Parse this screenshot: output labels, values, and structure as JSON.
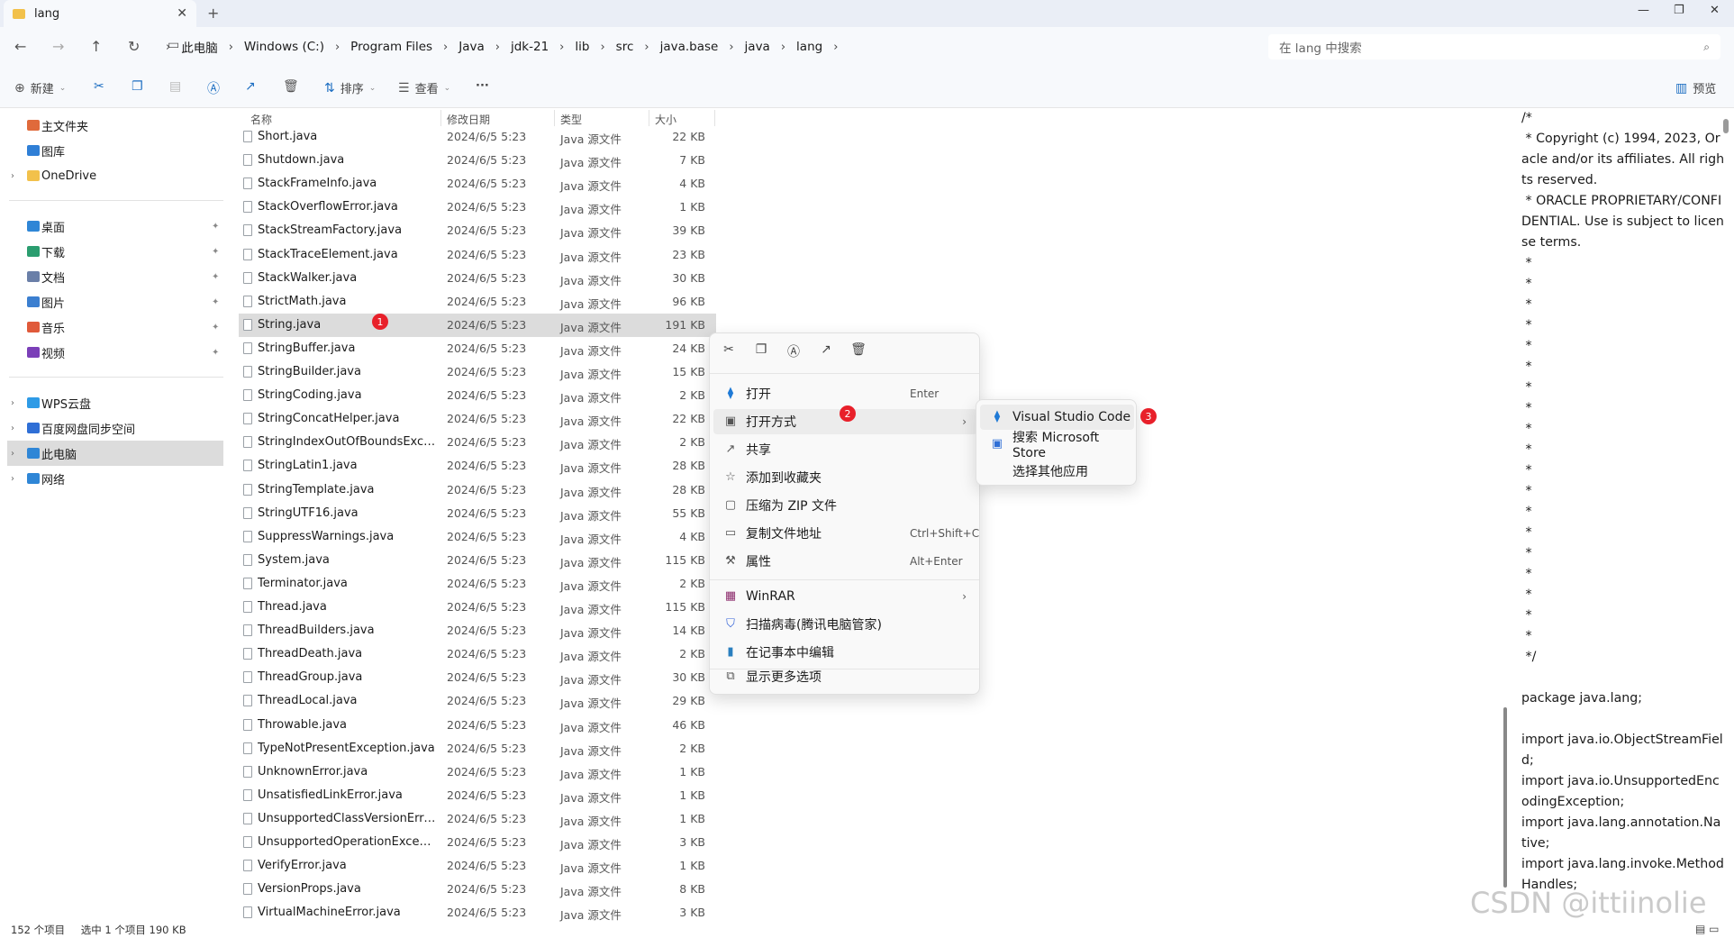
{
  "window": {
    "tab_title": "lang",
    "tab_close": "✕",
    "new_tab": "+",
    "minimize": "—",
    "restore": "❐",
    "close": "✕"
  },
  "address": {
    "crumbs": [
      "此电脑",
      "Windows (C:)",
      "Program Files",
      "Java",
      "jdk-21",
      "lib",
      "src",
      "java.base",
      "java",
      "lang"
    ],
    "search_placeholder": "在 lang 中搜索"
  },
  "toolbar": {
    "new_label": "新建",
    "sort_label": "排序",
    "view_label": "查看",
    "more_label": "···",
    "preview_label": "预览"
  },
  "sidebar": {
    "quick": [
      {
        "label": "主文件夹",
        "color": "#e06a3b"
      },
      {
        "label": "图库",
        "color": "#2f7fd6"
      },
      {
        "label": "OneDrive",
        "color": "#f2c14b"
      }
    ],
    "pinned": [
      {
        "label": "桌面",
        "color": "#2f86d6"
      },
      {
        "label": "下载",
        "color": "#2a9d6f"
      },
      {
        "label": "文档",
        "color": "#6a7fa8"
      },
      {
        "label": "图片",
        "color": "#3b7fd0"
      },
      {
        "label": "音乐",
        "color": "#e05a3a"
      },
      {
        "label": "视频",
        "color": "#7b3fb8"
      }
    ],
    "places": [
      {
        "label": "WPS云盘",
        "color": "#2e9be6"
      },
      {
        "label": "百度网盘同步空间",
        "color": "#2f6fd6"
      },
      {
        "label": "此电脑",
        "color": "#2f86d6"
      },
      {
        "label": "网络",
        "color": "#2f86d6"
      }
    ]
  },
  "list": {
    "headers": {
      "name": "名称",
      "date": "修改日期",
      "type": "类型",
      "size": "大小"
    },
    "rows": [
      {
        "name": "Short.java",
        "date": "2024/6/5 5:23",
        "type": "Java 源文件",
        "size": "22 KB"
      },
      {
        "name": "Shutdown.java",
        "date": "2024/6/5 5:23",
        "type": "Java 源文件",
        "size": "7 KB"
      },
      {
        "name": "StackFrameInfo.java",
        "date": "2024/6/5 5:23",
        "type": "Java 源文件",
        "size": "4 KB"
      },
      {
        "name": "StackOverflowError.java",
        "date": "2024/6/5 5:23",
        "type": "Java 源文件",
        "size": "1 KB"
      },
      {
        "name": "StackStreamFactory.java",
        "date": "2024/6/5 5:23",
        "type": "Java 源文件",
        "size": "39 KB"
      },
      {
        "name": "StackTraceElement.java",
        "date": "2024/6/5 5:23",
        "type": "Java 源文件",
        "size": "23 KB"
      },
      {
        "name": "StackWalker.java",
        "date": "2024/6/5 5:23",
        "type": "Java 源文件",
        "size": "30 KB"
      },
      {
        "name": "StrictMath.java",
        "date": "2024/6/5 5:23",
        "type": "Java 源文件",
        "size": "96 KB"
      },
      {
        "name": "String.java",
        "date": "2024/6/5 5:23",
        "type": "Java 源文件",
        "size": "191 KB"
      },
      {
        "name": "StringBuffer.java",
        "date": "2024/6/5 5:23",
        "type": "Java 源文件",
        "size": "24 KB"
      },
      {
        "name": "StringBuilder.java",
        "date": "2024/6/5 5:23",
        "type": "Java 源文件",
        "size": "15 KB"
      },
      {
        "name": "StringCoding.java",
        "date": "2024/6/5 5:23",
        "type": "Java 源文件",
        "size": "2 KB"
      },
      {
        "name": "StringConcatHelper.java",
        "date": "2024/6/5 5:23",
        "type": "Java 源文件",
        "size": "22 KB"
      },
      {
        "name": "StringIndexOutOfBoundsExcepti...",
        "date": "2024/6/5 5:23",
        "type": "Java 源文件",
        "size": "2 KB"
      },
      {
        "name": "StringLatin1.java",
        "date": "2024/6/5 5:23",
        "type": "Java 源文件",
        "size": "28 KB"
      },
      {
        "name": "StringTemplate.java",
        "date": "2024/6/5 5:23",
        "type": "Java 源文件",
        "size": "28 KB"
      },
      {
        "name": "StringUTF16.java",
        "date": "2024/6/5 5:23",
        "type": "Java 源文件",
        "size": "55 KB"
      },
      {
        "name": "SuppressWarnings.java",
        "date": "2024/6/5 5:23",
        "type": "Java 源文件",
        "size": "4 KB"
      },
      {
        "name": "System.java",
        "date": "2024/6/5 5:23",
        "type": "Java 源文件",
        "size": "115 KB"
      },
      {
        "name": "Terminator.java",
        "date": "2024/6/5 5:23",
        "type": "Java 源文件",
        "size": "2 KB"
      },
      {
        "name": "Thread.java",
        "date": "2024/6/5 5:23",
        "type": "Java 源文件",
        "size": "115 KB"
      },
      {
        "name": "ThreadBuilders.java",
        "date": "2024/6/5 5:23",
        "type": "Java 源文件",
        "size": "14 KB"
      },
      {
        "name": "ThreadDeath.java",
        "date": "2024/6/5 5:23",
        "type": "Java 源文件",
        "size": "2 KB"
      },
      {
        "name": "ThreadGroup.java",
        "date": "2024/6/5 5:23",
        "type": "Java 源文件",
        "size": "30 KB"
      },
      {
        "name": "ThreadLocal.java",
        "date": "2024/6/5 5:23",
        "type": "Java 源文件",
        "size": "29 KB"
      },
      {
        "name": "Throwable.java",
        "date": "2024/6/5 5:23",
        "type": "Java 源文件",
        "size": "46 KB"
      },
      {
        "name": "TypeNotPresentException.java",
        "date": "2024/6/5 5:23",
        "type": "Java 源文件",
        "size": "2 KB"
      },
      {
        "name": "UnknownError.java",
        "date": "2024/6/5 5:23",
        "type": "Java 源文件",
        "size": "1 KB"
      },
      {
        "name": "UnsatisfiedLinkError.java",
        "date": "2024/6/5 5:23",
        "type": "Java 源文件",
        "size": "1 KB"
      },
      {
        "name": "UnsupportedClassVersionError.ja...",
        "date": "2024/6/5 5:23",
        "type": "Java 源文件",
        "size": "1 KB"
      },
      {
        "name": "UnsupportedOperationExceptio...",
        "date": "2024/6/5 5:23",
        "type": "Java 源文件",
        "size": "3 KB"
      },
      {
        "name": "VerifyError.java",
        "date": "2024/6/5 5:23",
        "type": "Java 源文件",
        "size": "1 KB"
      },
      {
        "name": "VersionProps.java",
        "date": "2024/6/5 5:23",
        "type": "Java 源文件",
        "size": "8 KB"
      },
      {
        "name": "VirtualMachineError.java",
        "date": "2024/6/5 5:23",
        "type": "Java 源文件",
        "size": "3 KB"
      }
    ]
  },
  "badges": {
    "one": "1",
    "two": "2",
    "three": "3"
  },
  "context_menu": {
    "open": "打开",
    "open_shortcut": "Enter",
    "open_with": "打开方式",
    "share": "共享",
    "add_favorite": "添加到收藏夹",
    "zip": "压缩为 ZIP 文件",
    "copy_path": "复制文件地址",
    "copy_path_shortcut": "Ctrl+Shift+C",
    "properties": "属性",
    "properties_shortcut": "Alt+Enter",
    "winrar": "WinRAR",
    "scan": "扫描病毒(腾讯电脑管家)",
    "notepad": "在记事本中编辑",
    "more_options": "显示更多选项"
  },
  "submenu": {
    "vscode": "Visual Studio Code",
    "store": "搜索 Microsoft Store",
    "other": "选择其他应用"
  },
  "preview": {
    "code": "/*\n * Copyright (c) 1994, 2023, Oracle and/or its affiliates. All rights reserved.\n * ORACLE PROPRIETARY/CONFIDENTIAL. Use is subject to license terms.\n *\n *\n *\n *\n *\n *\n *\n *\n *\n *\n *\n *\n *\n *\n *\n *\n *\n *\n *\n */\n\npackage java.lang;\n\nimport java.io.ObjectStreamField;\nimport java.io.UnsupportedEncodingException;\nimport java.lang.annotation.Native;\nimport java.lang.invoke.MethodHandles;"
  },
  "status": {
    "count": "152 个项目",
    "selected": "选中 1 个项目  190 KB"
  },
  "watermark": "CSDN @ittiinolie"
}
